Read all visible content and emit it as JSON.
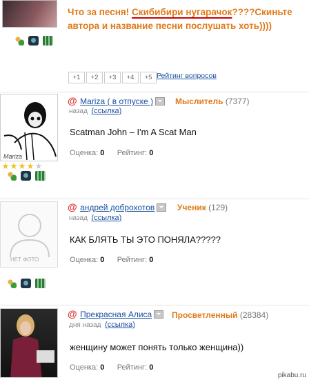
{
  "question": {
    "part1": "Что за песня! ",
    "highlight": "Скибибири нугарачок",
    "part2": "????Скиньте",
    "line2": "автора и название песни послушать хоть))))"
  },
  "pager": [
    "+1",
    "+2",
    "+3",
    "+4",
    "+5"
  ],
  "rating_link": "Рейтинг вопросов",
  "answers": [
    {
      "user": "Mariza ( в отпуске )",
      "rank": "Мыслитель",
      "rank_count": "(7377)",
      "time": "назад",
      "link": "(ссылка)",
      "text": "Scatman John – I'm A Scat Man",
      "score_label": "Оценка:",
      "score": "0",
      "rating_label": "Рейтинг:",
      "rating": "0",
      "avatar_caption": "Mariza"
    },
    {
      "user": "андрей доброхотов",
      "rank": "Ученик",
      "rank_count": "(129)",
      "time": "назад",
      "link": "(ссылка)",
      "text": "КАК БЛЯТЬ ТЫ ЭТО ПОНЯЛА?????",
      "score_label": "Оценка:",
      "score": "0",
      "rating_label": "Рейтинг:",
      "rating": "0",
      "avatar_caption": "НЕТ ФОТО"
    },
    {
      "user": "Прекрасная Алиса",
      "rank": "Просветленный",
      "rank_count": "(28384)",
      "time": "дня назад",
      "link": "(ссылка)",
      "text": "женщину может понять только женщина))",
      "score_label": "Оценка:",
      "score": "0",
      "rating_label": "Рейтинг:",
      "rating": "0"
    }
  ],
  "watermark": "pikabu.ru",
  "colors": {
    "accent": "#e07a1a",
    "link": "#1a4fa0",
    "at": "#dd3333"
  }
}
